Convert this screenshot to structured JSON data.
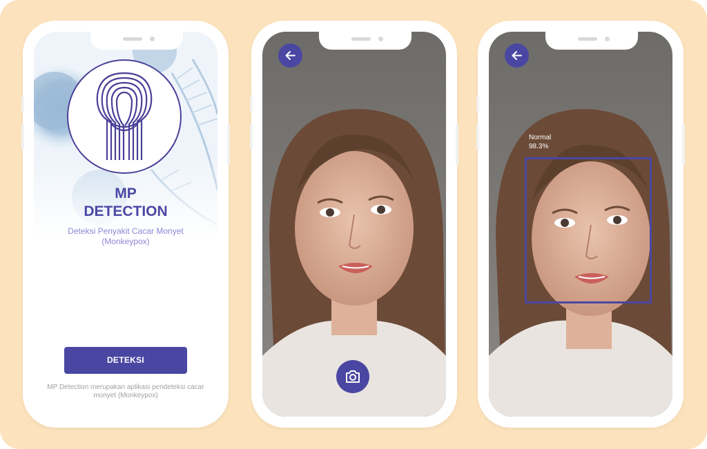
{
  "screen1": {
    "title_line1": "MP",
    "title_line2": "DETECTION",
    "subtitle": "Deteksi Penyakit Cacar Monyet (Monkeypox)",
    "button_label": "DETEKSI",
    "footer": "MP Detection merupakan aplikasi pendeteksi cacar monyet (Monkeypox)"
  },
  "screen2": {
    "back_icon": "arrow-left-icon",
    "camera_icon": "camera-icon"
  },
  "screen3": {
    "back_icon": "arrow-left-icon",
    "detection": {
      "label": "Normal",
      "confidence": "98.3%"
    }
  },
  "colors": {
    "background": "#fde3bd",
    "accent": "#4a47a3",
    "subtitle": "#8c86d6"
  }
}
